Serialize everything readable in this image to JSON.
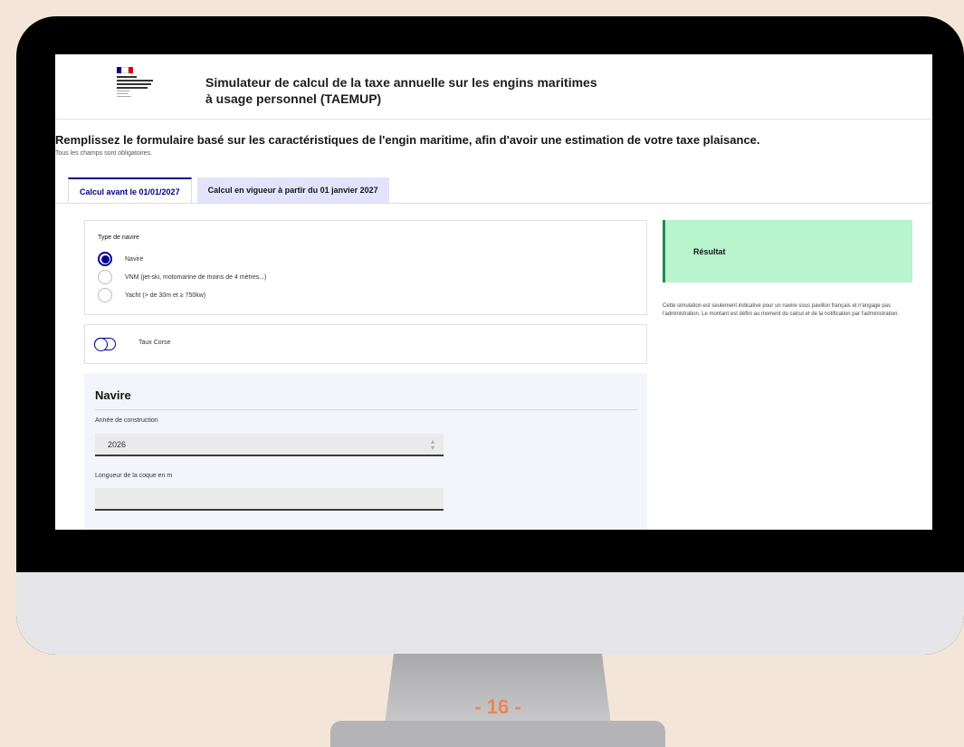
{
  "header": {
    "logo_text": "MINISTÈRE CHARGÉ DE LA MER ET DE LA PÊCHE — Liberté Égalité Fraternité",
    "title": "Simulateur de calcul de la taxe annuelle sur les engins maritimes à usage personnel (TAEMUP)"
  },
  "intro": {
    "title": "Remplissez le formulaire basé sur les caractéristiques de l'engin maritime, afin d'avoir une estimation de votre taxe plaisance.",
    "subtitle": "Tous les champs sont obligatoires."
  },
  "tabs": [
    {
      "label": "Calcul avant le 01/01/2027",
      "active": true
    },
    {
      "label": "Calcul en vigueur à partir du 01 janvier 2027",
      "active": false
    }
  ],
  "vessel_type": {
    "legend": "Type de navire",
    "options": [
      {
        "label": "Navire",
        "checked": true
      },
      {
        "label": "VNM (jet-ski, motomarine de moins de 4 mètres...)",
        "checked": false
      },
      {
        "label": "Yacht (> de 30m et ≥ 750kw)",
        "checked": false
      }
    ]
  },
  "toggle": {
    "label": "Taux Corse",
    "on": false
  },
  "navire_section": {
    "title": "Navire",
    "year_label": "Année de construction",
    "year_value": "2026",
    "hull_label": "Longueur de la coque en m",
    "hull_value": ""
  },
  "result": {
    "title": "Résultat",
    "note": "Cette simulation est seulement indicative pour un navire sous pavillon français et n'engage pas l'administration. Le montant est défini au moment du calcul et de la notification par l'administration."
  },
  "page_number": "- 16 -",
  "colors": {
    "accent": "#000091",
    "result_bg": "#b8f4cd",
    "result_border": "#1f8d49",
    "page_number": "#f08550",
    "background": "#f3e6d8"
  },
  "icons": {
    "spinner": "up-down-arrows-icon",
    "toggle": "toggle-switch-icon"
  }
}
